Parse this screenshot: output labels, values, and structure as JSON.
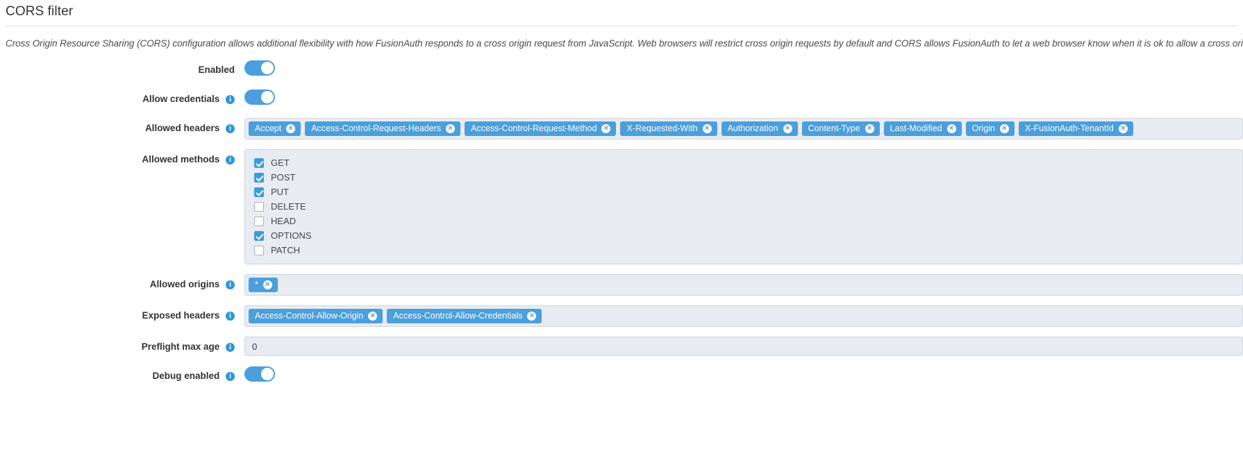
{
  "panel": {
    "title": "CORS filter",
    "description": "Cross Origin Resource Sharing (CORS) configuration allows additional flexibility with how FusionAuth responds to a cross origin request from JavaScript. Web browsers will restrict cross origin requests by default and CORS allows FusionAuth to let a web browser know when it is ok to allow a cross origin request."
  },
  "icons": {
    "info": "i",
    "chip_remove": "✕"
  },
  "colors": {
    "accent": "#4a9fdc",
    "field_bg": "#e8ecf2",
    "field_border": "#cfd6e0",
    "checkbox_checked": "#3d9ae0"
  },
  "rows": {
    "enabled": {
      "label": "Enabled",
      "has_info": false,
      "value": true
    },
    "allow_credentials": {
      "label": "Allow credentials",
      "has_info": true,
      "value": true
    },
    "allowed_headers": {
      "label": "Allowed headers",
      "has_info": true
    },
    "allowed_methods": {
      "label": "Allowed methods",
      "has_info": true
    },
    "allowed_origins": {
      "label": "Allowed origins",
      "has_info": true
    },
    "exposed_headers": {
      "label": "Exposed headers",
      "has_info": true
    },
    "preflight_max_age": {
      "label": "Preflight max age",
      "has_info": true,
      "value": "0"
    },
    "debug_enabled": {
      "label": "Debug enabled",
      "has_info": true,
      "value": true
    }
  },
  "allowed_headers": [
    "Accept",
    "Access-Control-Request-Headers",
    "Access-Control-Request-Method",
    "X-Requested-With",
    "Authorization",
    "Content-Type",
    "Last-Modified",
    "Origin",
    "X-FusionAuth-TenantId"
  ],
  "allowed_methods": [
    {
      "label": "GET",
      "checked": true
    },
    {
      "label": "POST",
      "checked": true
    },
    {
      "label": "PUT",
      "checked": true
    },
    {
      "label": "DELETE",
      "checked": false
    },
    {
      "label": "HEAD",
      "checked": false
    },
    {
      "label": "OPTIONS",
      "checked": true
    },
    {
      "label": "PATCH",
      "checked": false
    }
  ],
  "allowed_origins": [
    "*"
  ],
  "exposed_headers": [
    "Access-Control-Allow-Origin",
    "Access-Control-Allow-Credentials"
  ]
}
